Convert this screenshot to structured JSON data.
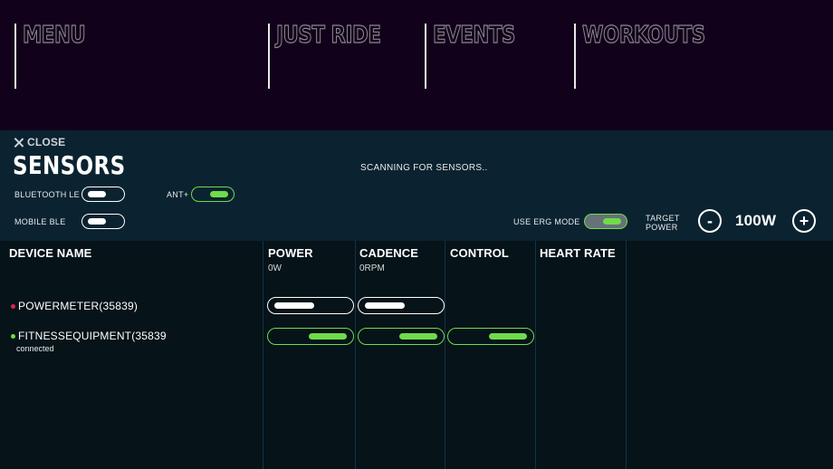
{
  "nav": [
    {
      "label": "MENU"
    },
    {
      "label": "JUST RIDE"
    },
    {
      "label": "EVENTS"
    },
    {
      "label": "WORKOUTS"
    }
  ],
  "panel": {
    "close_label": "CLOSE",
    "title": "SENSORS",
    "scanning": "SCANNING FOR SENSORS..",
    "bluetooth_label": "BLUETOOTH  LE",
    "ant_label": "ANT+",
    "mobile_label": "MOBILE BLE",
    "erg_label": "USE ERG MODE",
    "target_power_line1": "TARGET",
    "target_power_line2": "POWER",
    "minus": "-",
    "plus": "+",
    "power_value": "100W",
    "toggles": {
      "bluetooth_le": false,
      "ant_plus": true,
      "mobile_ble": false,
      "erg_mode": true
    }
  },
  "table": {
    "columns": [
      {
        "title": "DEVICE NAME",
        "sub": ""
      },
      {
        "title": "POWER",
        "sub": "0W"
      },
      {
        "title": "CADENCE",
        "sub": "0RPM"
      },
      {
        "title": "CONTROL",
        "sub": ""
      },
      {
        "title": "HEART RATE",
        "sub": ""
      }
    ],
    "devices": [
      {
        "name": "POWERMETER(35839)",
        "status": "",
        "dot_color": "#e0234e"
      },
      {
        "name": "FITNESSEQUIPMENT(35839",
        "status": "connected",
        "dot_color": "#6fdc4a"
      }
    ]
  },
  "colors": {
    "accent_green": "#6fdc4a",
    "nav_bg": "#12011b",
    "panel_bg": "#0b2330",
    "table_bg": "#061318"
  }
}
